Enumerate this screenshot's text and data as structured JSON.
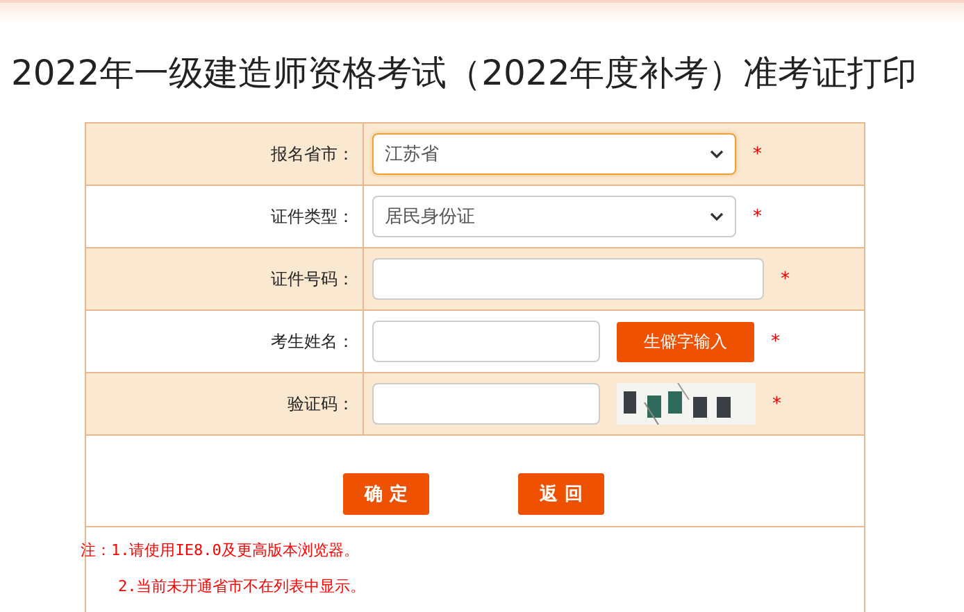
{
  "title": "2022年一级建造师资格考试（2022年度补考）准考证打印",
  "form": {
    "rows": [
      {
        "label": "报名省市：",
        "kind": "select",
        "value": "江苏省",
        "focused": true,
        "required_mark": "*"
      },
      {
        "label": "证件类型：",
        "kind": "select",
        "value": "居民身份证",
        "focused": false,
        "required_mark": "*"
      },
      {
        "label": "证件号码：",
        "kind": "input",
        "required_mark": "*"
      },
      {
        "label": "考生姓名：",
        "kind": "input_button",
        "button": "生僻字输入",
        "required_mark": "*"
      },
      {
        "label": "验证码：",
        "kind": "captcha",
        "required_mark": "*"
      }
    ],
    "buttons": [
      "确 定",
      "返 回"
    ],
    "notes": [
      "注：1.请使用IE8.0及更高版本浏览器。",
      "2.当前未开通省市不在列表中显示。"
    ]
  }
}
